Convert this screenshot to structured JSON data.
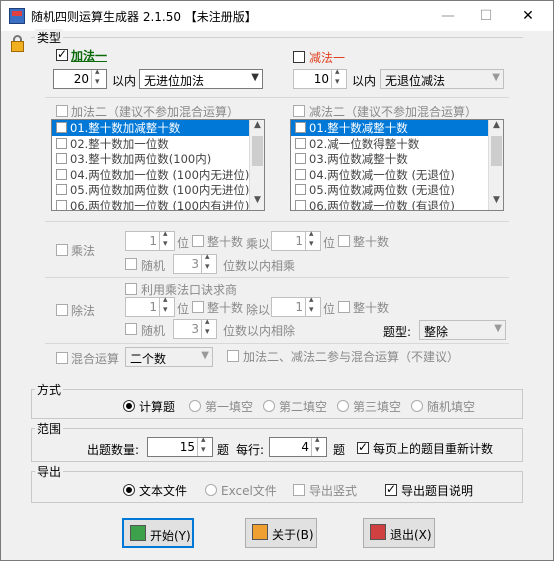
{
  "window": {
    "title": "随机四则运算生成器 2.1.50 【未注册版】",
    "min": "—",
    "max": "☐",
    "close": "✕"
  },
  "type_section": {
    "legend": "类型",
    "add1": {
      "label": "加法一",
      "checked": true,
      "range": "20",
      "unit": "以内",
      "mode": "无进位加法"
    },
    "sub1": {
      "label": "减法一",
      "checked": false,
      "range": "10",
      "unit": "以内",
      "mode": "无退位减法"
    },
    "add2": {
      "label": "加法二（建议不参加混合运算）",
      "items": [
        "01.整十数加减整十数",
        "02.整十数加一位数",
        "03.整十数加两位数(100内)",
        "04.两位数加一位数 (100内无进位)",
        "05.两位数加两位数 (100内无进位)",
        "06.两位数加一位数 (100内有进位)"
      ]
    },
    "sub2": {
      "label": "减法二（建议不参加混合运算）",
      "items": [
        "01.整十数减整十数",
        "02.减一位数得整十数",
        "03.两位数减整十数",
        "04.两位数减一位数 (无退位)",
        "05.两位数减两位数 (无退位)",
        "06.两位数减一位数 (有退位)"
      ]
    },
    "mul": {
      "label": "乘法",
      "d1": "1",
      "pos": "位",
      "tens1": "整十数",
      "op": "乘以",
      "d2": "1",
      "tens2": "整十数",
      "random": "随机",
      "rd": "3",
      "rtext": "位数以内相乘"
    },
    "div": {
      "label": "除法",
      "use_table": "利用乘法口诀求商",
      "d1": "1",
      "pos": "位",
      "tens1": "整十数",
      "op": "除以",
      "d2": "1",
      "tens2": "整十数",
      "random": "随机",
      "rd": "3",
      "rtext": "位数以内相除",
      "qtype_label": "题型:",
      "qtype": "整除"
    },
    "mix": {
      "label": "混合运算",
      "count": "二个数",
      "note": "加法二、减法二参与混合运算（不建议）"
    }
  },
  "mode_section": {
    "legend": "方式",
    "options": [
      "计算题",
      "第一填空",
      "第二填空",
      "第三填空",
      "随机填空"
    ],
    "selected": 0
  },
  "range_section": {
    "legend": "范围",
    "count_label": "出题数量:",
    "count": "15",
    "unit1": "题",
    "row_label": "每行:",
    "row": "4",
    "unit2": "题",
    "recount": "每页上的题目重新计数",
    "recount_checked": true
  },
  "export_section": {
    "legend": "导出",
    "text_file": "文本文件",
    "excel": "Excel文件",
    "vertical": "导出竖式",
    "explain": "导出题目说明",
    "explain_checked": true
  },
  "buttons": {
    "start": "开始(Y)",
    "about": "关于(B)",
    "exit": "退出(X)"
  },
  "colors": {
    "accent": "#0078d7",
    "red": "#e04020",
    "green": "#0a6a0a"
  }
}
